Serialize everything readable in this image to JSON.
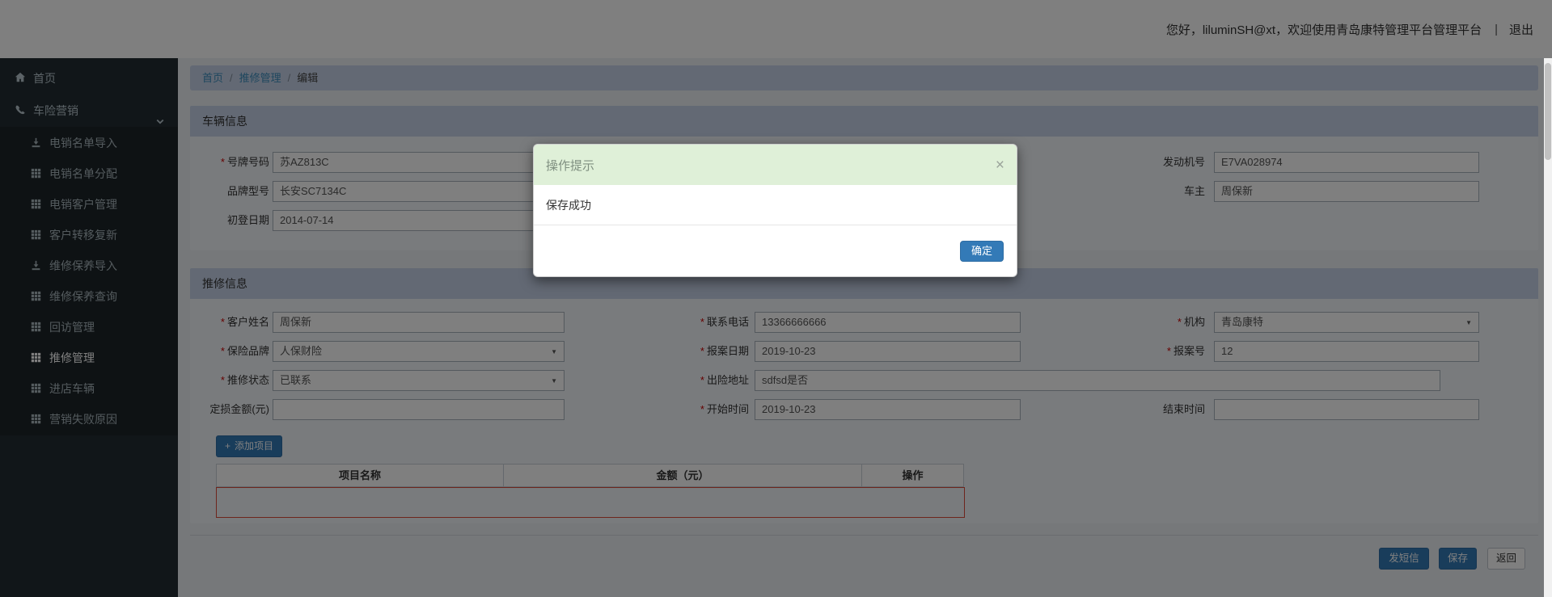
{
  "topbar": {
    "greeting": "您好，liluminSH@xt，欢迎使用青岛康特管理平台管理平台",
    "divider": "|",
    "logout": "退出"
  },
  "sidebar": {
    "home": {
      "label": "首页"
    },
    "menu": {
      "label": "车险营销"
    },
    "submenu": [
      {
        "label": "电销名单导入",
        "icon": "import-icon"
      },
      {
        "label": "电销名单分配",
        "icon": "grid-icon"
      },
      {
        "label": "电销客户管理",
        "icon": "grid-icon"
      },
      {
        "label": "客户转移复新",
        "icon": "grid-icon"
      },
      {
        "label": "维修保养导入",
        "icon": "import-icon"
      },
      {
        "label": "维修保养查询",
        "icon": "grid-icon"
      },
      {
        "label": "回访管理",
        "icon": "grid-icon"
      },
      {
        "label": "推修管理",
        "icon": "grid-icon",
        "active": true
      },
      {
        "label": "进店车辆",
        "icon": "grid-icon"
      },
      {
        "label": "营销失败原因",
        "icon": "grid-icon"
      }
    ]
  },
  "breadcrumb": {
    "items": [
      "首页",
      "推修管理",
      "编辑"
    ],
    "separator": "/"
  },
  "vehicle": {
    "title": "车辆信息",
    "fields": {
      "plate": {
        "label": "号牌号码",
        "value": "苏AZ813C",
        "required": true
      },
      "model": {
        "label": "品牌型号",
        "value": "长安SC7134C"
      },
      "first_reg_date": {
        "label": "初登日期",
        "value": "2014-07-14"
      },
      "engine_no": {
        "label": "发动机号",
        "value": "E7VA028974"
      },
      "owner": {
        "label": "车主",
        "value": "周保新"
      }
    }
  },
  "repair": {
    "title": "推修信息",
    "fields": {
      "customer_name": {
        "label": "客户姓名",
        "value": "周保新",
        "required": true
      },
      "contact_phone": {
        "label": "联系电话",
        "value": "13366666666",
        "required": true
      },
      "organization": {
        "label": "机构",
        "value": "青岛康特",
        "required": true,
        "control": "select"
      },
      "insurance_brand": {
        "label": "保险品牌",
        "value": "人保财险",
        "required": true,
        "control": "select"
      },
      "report_date": {
        "label": "报案日期",
        "value": "2019-10-23",
        "required": true
      },
      "report_no": {
        "label": "报案号",
        "value": "12",
        "required": true
      },
      "repair_status": {
        "label": "推修状态",
        "value": "已联系",
        "required": true,
        "control": "select"
      },
      "accident_address": {
        "label": "出险地址",
        "value": "sdfsd是否",
        "required": true
      },
      "loss_amount": {
        "label": "定损金额(元)",
        "value": ""
      },
      "start_time": {
        "label": "开始时间",
        "value": "2019-10-23",
        "required": true
      },
      "end_time": {
        "label": "结束时间",
        "value": ""
      }
    },
    "add_item_label": "添加项目",
    "table": {
      "headers": [
        "项目名称",
        "金额（元）",
        "操作"
      ],
      "rows": []
    }
  },
  "footer": {
    "send_sms": "发短信",
    "save": "保存",
    "back": "返回"
  },
  "modal": {
    "title": "操作提示",
    "message": "保存成功",
    "confirm": "确定"
  },
  "icons": {
    "required_marker": "*",
    "caret": "▼",
    "close": "×",
    "plus": "+"
  },
  "colors": {
    "primary": "#337ab7",
    "modal_header_bg": "#dff0d8",
    "error_border": "#dd4b39",
    "sidebar_bg": "#222d32",
    "panel_header_bg": "#c6d3e8",
    "link": "#3c8dbc"
  }
}
